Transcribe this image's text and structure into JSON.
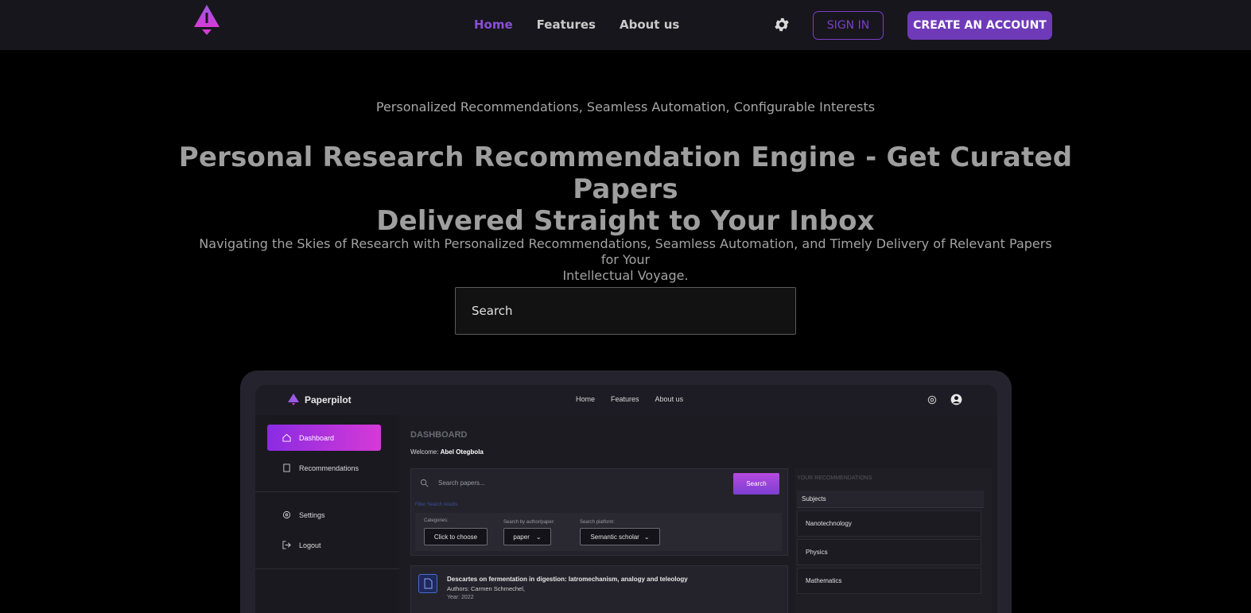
{
  "nav": {
    "links": [
      "Home",
      "Features",
      "About us"
    ],
    "signin_label": "SIGN IN",
    "create_label": "CREATE AN ACCOUNT",
    "icons": [
      "logo-icon",
      "gear-icon"
    ]
  },
  "hero": {
    "tagline": "Personalized Recommendations, Seamless Automation, Configurable Interests",
    "headline_line1": "Personal Research Recommendation Engine - Get Curated Papers",
    "headline_line2": "Delivered Straight to Your Inbox",
    "subtext_line1": "Navigating the Skies of Research with Personalized Recommendations, Seamless Automation, and Timely Delivery of Relevant Papers for Your",
    "subtext_line2": "Intellectual Voyage.",
    "search_placeholder": "Search"
  },
  "preview": {
    "brand": "Paperpilot",
    "links": [
      "Home",
      "Features",
      "About us"
    ],
    "sidebar": {
      "dashboard": "Dashboard",
      "recommendations": "Recommendations",
      "settings": "Settings",
      "logout": "Logout"
    },
    "dashboard_title": "DASHBOARD",
    "welcome_label": "Welcome: ",
    "welcome_name": "Abel Otegbola",
    "search_placeholder": "Search papers...",
    "search_button": "Search",
    "filter_link": "Filter Search results",
    "filters": {
      "categories_label": "Categories:",
      "categories_value": "Click to choose",
      "author_label": "Search by author/paper:",
      "author_value": "paper",
      "platform_label": "Search platform:",
      "platform_value": "Semantic scholar"
    },
    "paper": {
      "title": "Descartes on fermentation in digestion: Iatromechanism, analogy and teleology",
      "authors": "Authors: Carmen Schmechel,",
      "year": "Year: 2022"
    },
    "recommendations": {
      "title": "YOUR RECOMMENDATIONS",
      "subjects_label": "Subjects",
      "subjects": [
        "Nanotechnology",
        "Physics",
        "Mathematics"
      ]
    }
  },
  "colors": {
    "accent": "#6f3ab8",
    "active_link": "#8a4fd6",
    "gradient_start": "#8a2be2",
    "gradient_end": "#d63ad6"
  }
}
